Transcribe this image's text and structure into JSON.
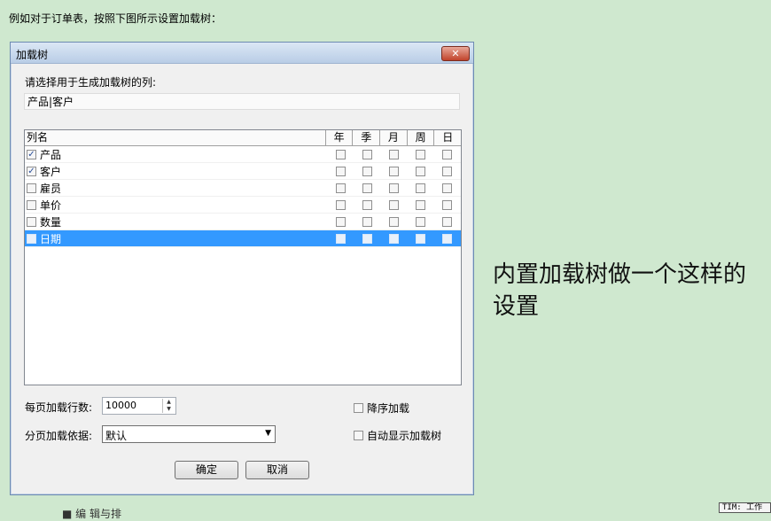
{
  "intro": "例如对于订单表，按照下图所示设置加载树：",
  "dialog": {
    "title": "加载树",
    "close_glyph": "✕",
    "choose_label": "请选择用于生成加载树的列:",
    "selected_columns": "产品|客户",
    "grid": {
      "headers": [
        "列名",
        "年",
        "季",
        "月",
        "周",
        "日"
      ],
      "rows": [
        {
          "name": "产品",
          "checked": true,
          "selected": false
        },
        {
          "name": "客户",
          "checked": true,
          "selected": false
        },
        {
          "name": "雇员",
          "checked": false,
          "selected": false
        },
        {
          "name": "单价",
          "checked": false,
          "selected": false
        },
        {
          "name": "数量",
          "checked": false,
          "selected": false
        },
        {
          "name": "日期",
          "checked": false,
          "selected": true
        }
      ]
    },
    "rows_per_page_label": "每页加载行数:",
    "rows_per_page_value": "10000",
    "page_basis_label": "分页加载依据:",
    "page_basis_value": "默认",
    "descending_label": "降序加载",
    "auto_show_label": "自动显示加载树",
    "ok_label": "确定",
    "cancel_label": "取消"
  },
  "side_note": "内置加载树做一个这样的设置",
  "corner_tag": "TIM: 工作",
  "bottom_fragment": "■ 编  辑与排"
}
